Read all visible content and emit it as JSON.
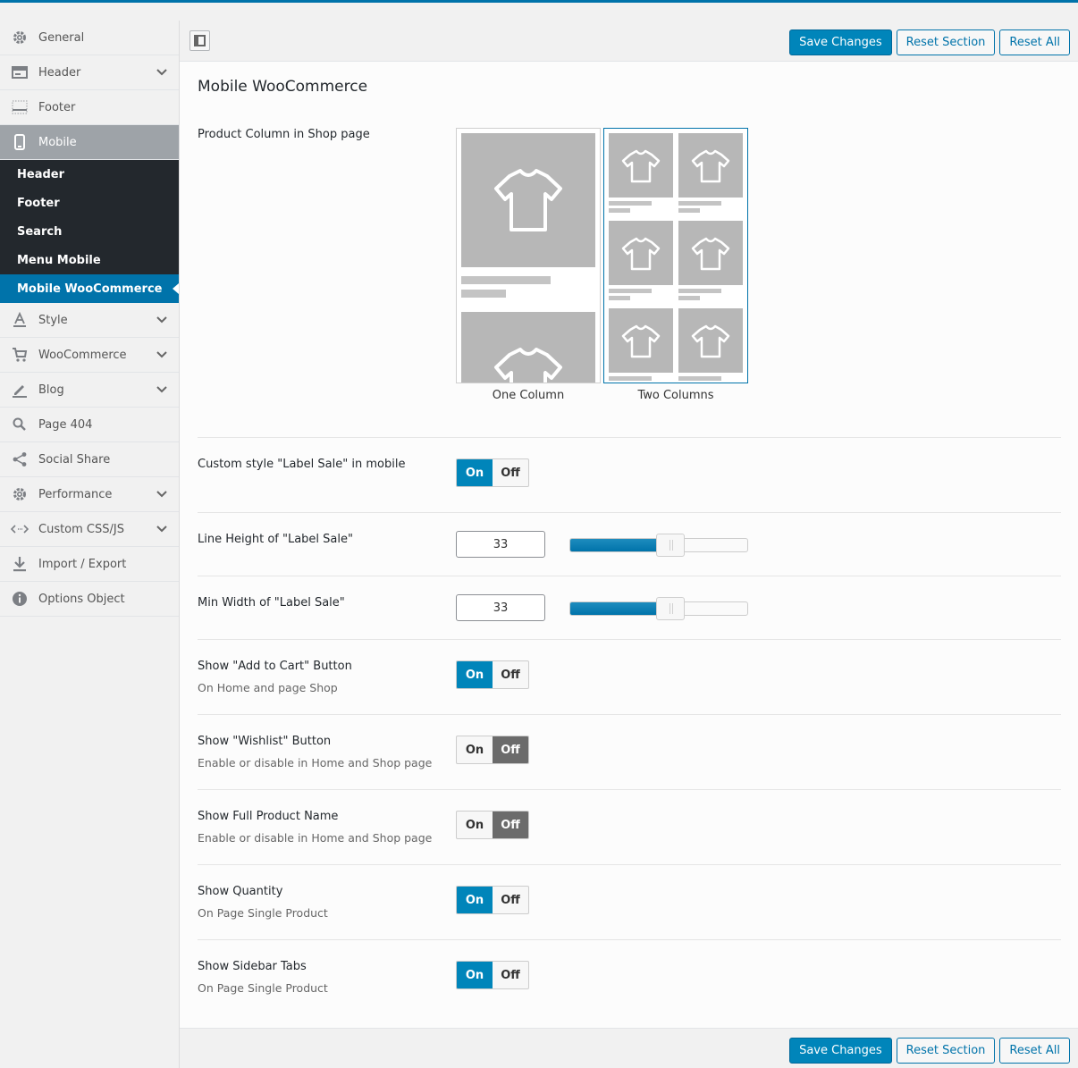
{
  "toolbar": {
    "save": "Save Changes",
    "reset_section": "Reset Section",
    "reset_all": "Reset All"
  },
  "sidebar": {
    "items_top": [
      {
        "label": "General",
        "icon": "gear-icon"
      },
      {
        "label": "Header",
        "icon": "header-icon"
      },
      {
        "label": "Footer",
        "icon": "footer-icon"
      },
      {
        "label": "Mobile",
        "icon": "phone-icon"
      }
    ],
    "sub_items": [
      "Header",
      "Footer",
      "Search",
      "Menu Mobile",
      "Mobile WooCommerce"
    ],
    "items_bottom": [
      {
        "label": "Style",
        "icon": "text-style-icon"
      },
      {
        "label": "WooCommerce",
        "icon": "cart-icon"
      },
      {
        "label": "Blog",
        "icon": "edit-icon"
      },
      {
        "label": "Page 404",
        "icon": "search-icon"
      },
      {
        "label": "Social Share",
        "icon": "share-icon"
      },
      {
        "label": "Performance",
        "icon": "gear-icon"
      },
      {
        "label": "Custom CSS/JS",
        "icon": "code-icon"
      },
      {
        "label": "Import / Export",
        "icon": "download-icon"
      },
      {
        "label": "Options Object",
        "icon": "info-icon"
      }
    ]
  },
  "main": {
    "title": "Mobile WooCommerce",
    "product_column": {
      "title": "Product Column in Shop page",
      "options": [
        "One Column",
        "Two Columns"
      ],
      "selected": "Two Columns"
    },
    "label_sale_style": {
      "title": "Custom style \"Label Sale\" in mobile",
      "value": "On"
    },
    "line_height": {
      "title": "Line Height of \"Label Sale\"",
      "value": "33",
      "level": 0.5
    },
    "min_width": {
      "title": "Min Width of \"Label Sale\"",
      "value": "33",
      "level": 0.5
    },
    "add_to_cart": {
      "title": "Show \"Add to Cart\" Button",
      "desc": "On Home and page Shop",
      "value": "On"
    },
    "wishlist": {
      "title": "Show \"Wishlist\" Button",
      "desc": "Enable or disable in Home and Shop page",
      "value": "Off"
    },
    "full_name": {
      "title": "Show Full Product Name",
      "desc": "Enable or disable in Home and Shop page",
      "value": "Off"
    },
    "quantity": {
      "title": "Show Quantity",
      "desc": "On Page Single Product",
      "value": "On"
    },
    "sidebar_tabs": {
      "title": "Show Sidebar Tabs",
      "desc": "On Page Single Product",
      "value": "On"
    },
    "on_label": "On",
    "off_label": "Off"
  }
}
